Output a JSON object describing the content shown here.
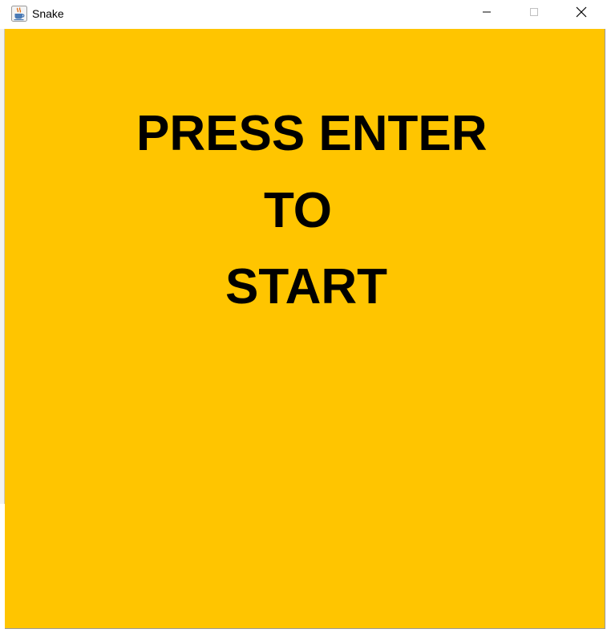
{
  "window": {
    "title": "Snake",
    "icon": "java-cup-icon",
    "controls": {
      "minimize_icon": "minimize-icon",
      "maximize_icon": "maximize-icon",
      "close_icon": "close-icon"
    }
  },
  "game": {
    "background_color": "#ffc500",
    "text_color": "#000000",
    "message_lines": [
      "PRESS ENTER",
      "TO",
      "START"
    ]
  }
}
